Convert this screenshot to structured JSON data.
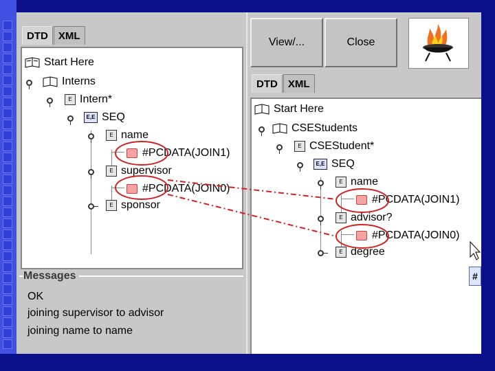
{
  "left_panel": {
    "tabs": [
      "DTD",
      "XML"
    ],
    "root_label": "Start Here",
    "nodes": {
      "interns": "Interns",
      "intern": "Intern*",
      "seq": "SEQ",
      "name": "name",
      "pcdata1": "#PCDATA(JOIN1)",
      "supervisor": "supervisor",
      "pcdata0": "#PCDATA(JOIN0)",
      "sponsor": "sponsor"
    },
    "messages": {
      "title": "Messages",
      "lines": [
        "OK",
        "joining supervisor to advisor",
        "joining name to name"
      ]
    }
  },
  "right_panel": {
    "buttons": {
      "view": "View/...",
      "close": "Close"
    },
    "tabs": [
      "DTD",
      "XML"
    ],
    "root_label": "Start Here",
    "nodes": {
      "students": "CSEStudents",
      "student": "CSEStudent*",
      "seq": "SEQ",
      "name": "name",
      "pcdata1": "#PCDATA(JOIN1)",
      "advisor": "advisor?",
      "pcdata0": "#PCDATA(JOIN0)",
      "degree": "degree"
    },
    "edge_button": "#"
  },
  "icons": {
    "element_icon_text": "E",
    "seq_icon_text": "E,E"
  },
  "colors": {
    "background_blue": "#0a0f8a",
    "annotation_red": "#d02020",
    "panel_gray": "#c8c8c8"
  }
}
